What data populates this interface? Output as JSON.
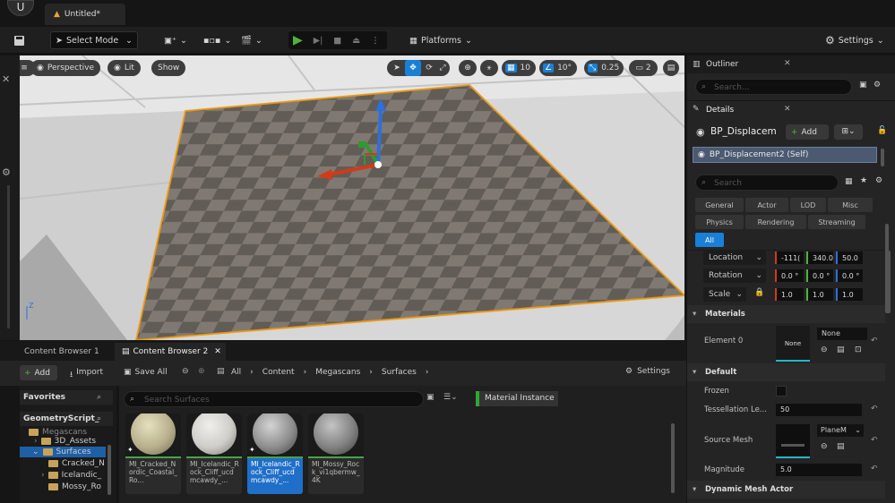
{
  "app": {
    "logo": "U",
    "tab_title": "Untitled*"
  },
  "toolbar": {
    "select_mode": "Select Mode",
    "platforms": "Platforms",
    "settings": "Settings"
  },
  "viewport": {
    "perspective": "Perspective",
    "lit": "Lit",
    "show": "Show",
    "grid_snap": "10",
    "rot_snap": "10°",
    "scale_snap": "0.25",
    "camera_speed": "2"
  },
  "outliner": {
    "title": "Outliner",
    "search_placeholder": "Search..."
  },
  "details": {
    "title": "Details",
    "object_name": "BP_Displacem",
    "add_label": "Add",
    "selected_component": "BP_Displacement2 (Self)",
    "search_placeholder": "Search",
    "categories": [
      "General",
      "Actor",
      "LOD",
      "Misc",
      "Physics",
      "Rendering",
      "Streaming",
      "All"
    ],
    "transform": {
      "location_label": "Location",
      "location": [
        "-111(",
        "340.0",
        "50.0"
      ],
      "rotation_label": "Rotation",
      "rotation": [
        "0.0 °",
        "0.0 °",
        "0.0 °"
      ],
      "scale_label": "Scale",
      "scale": [
        "1.0",
        "1.0",
        "1.0"
      ]
    },
    "materials_header": "Materials",
    "element0_label": "Element 0",
    "element0_thumb": "None",
    "element0_value": "None",
    "default_header": "Default",
    "frozen_label": "Frozen",
    "tessellation_label": "Tessellation Le...",
    "tessellation_value": "50",
    "source_mesh_label": "Source Mesh",
    "source_mesh_value": "PlaneM",
    "magnitude_label": "Magnitude",
    "magnitude_value": "5.0",
    "dynamic_header": "Dynamic Mesh Actor"
  },
  "content_browser": {
    "tab1": "Content Browser 1",
    "tab2": "Content Browser 2",
    "add": "Add",
    "import": "Import",
    "save_all": "Save All",
    "breadcrumb": [
      "All",
      "Content",
      "Megascans",
      "Surfaces"
    ],
    "settings": "Settings",
    "favorites": "Favorites",
    "geometry_script": "GeometryScript_",
    "search_placeholder": "Search Surfaces",
    "filter_chip": "Material Instance",
    "tree": [
      "Megascans",
      "3D_Assets",
      "Surfaces",
      "Cracked_N",
      "Icelandic_",
      "Mossy_Ro"
    ],
    "assets": [
      {
        "name": "MI_Cracked_Nordic_Coastal_Ro...",
        "color": "#c9c3a3",
        "selected": false
      },
      {
        "name": "MI_Icelandic_Rock_Cliff_ucdmcawdy_...",
        "color": "#d8d6d2",
        "selected": false
      },
      {
        "name": "MI_Icelandic_Rock_Cliff_ucdmcawdy_...",
        "color": "#9a9a9a",
        "selected": true
      },
      {
        "name": "MI_Mossy_Rock_vi1qbermw_4K",
        "color": "#8d8d8d",
        "selected": false
      }
    ]
  },
  "colors": {
    "accent_blue": "#1a7fd6",
    "selection_orange": "#f0a020",
    "play_green": "#4fb33b"
  }
}
